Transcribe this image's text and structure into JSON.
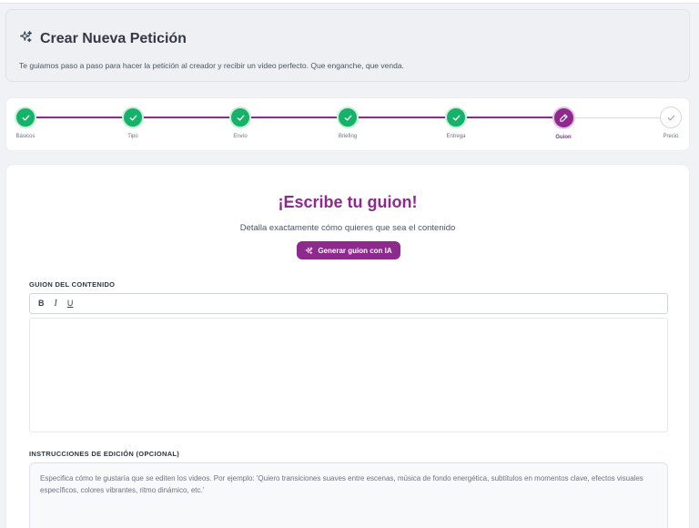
{
  "header": {
    "title": "Crear Nueva Petición",
    "subtitle": "Te guiamos paso a paso para hacer la petición al creador y recibir un video perfecto. Que enganche, que venda."
  },
  "stepper": {
    "steps": [
      {
        "label": "Básicos",
        "state": "done"
      },
      {
        "label": "Tipo",
        "state": "done"
      },
      {
        "label": "Envío",
        "state": "done"
      },
      {
        "label": "Briefing",
        "state": "done"
      },
      {
        "label": "Entrega",
        "state": "done"
      },
      {
        "label": "Guion",
        "state": "active"
      },
      {
        "label": "Precio",
        "state": "todo"
      }
    ]
  },
  "main": {
    "title": "¡Escribe tu guion!",
    "subtitle": "Detalla exactamente cómo quieres que sea el contenido",
    "ai_button_label": "Generar guion con IA",
    "script_label": "GUION DEL CONTENIDO",
    "toolbar": {
      "bold": "B",
      "italic": "I",
      "underline": "U"
    },
    "script_value": "",
    "instructions_label": "INSTRUCCIONES DE EDICIÓN (OPCIONAL)",
    "instructions_placeholder": "Especifica cómo te gustaría que se editen los videos. Por ejemplo: 'Quiero transiciones suaves entre escenas, música de fondo energética, subtítulos en momentos clave, efectos visuales específicos, colores vibrantes, ritmo dinámico, etc.'"
  },
  "colors": {
    "accent": "#8e2a8e",
    "success": "#17b26a",
    "background": "#f1f2f5"
  },
  "icons": {
    "header": "sparkles-icon",
    "step_done": "check-icon",
    "step_active": "pen-icon",
    "ai_button": "sparkles-icon"
  }
}
